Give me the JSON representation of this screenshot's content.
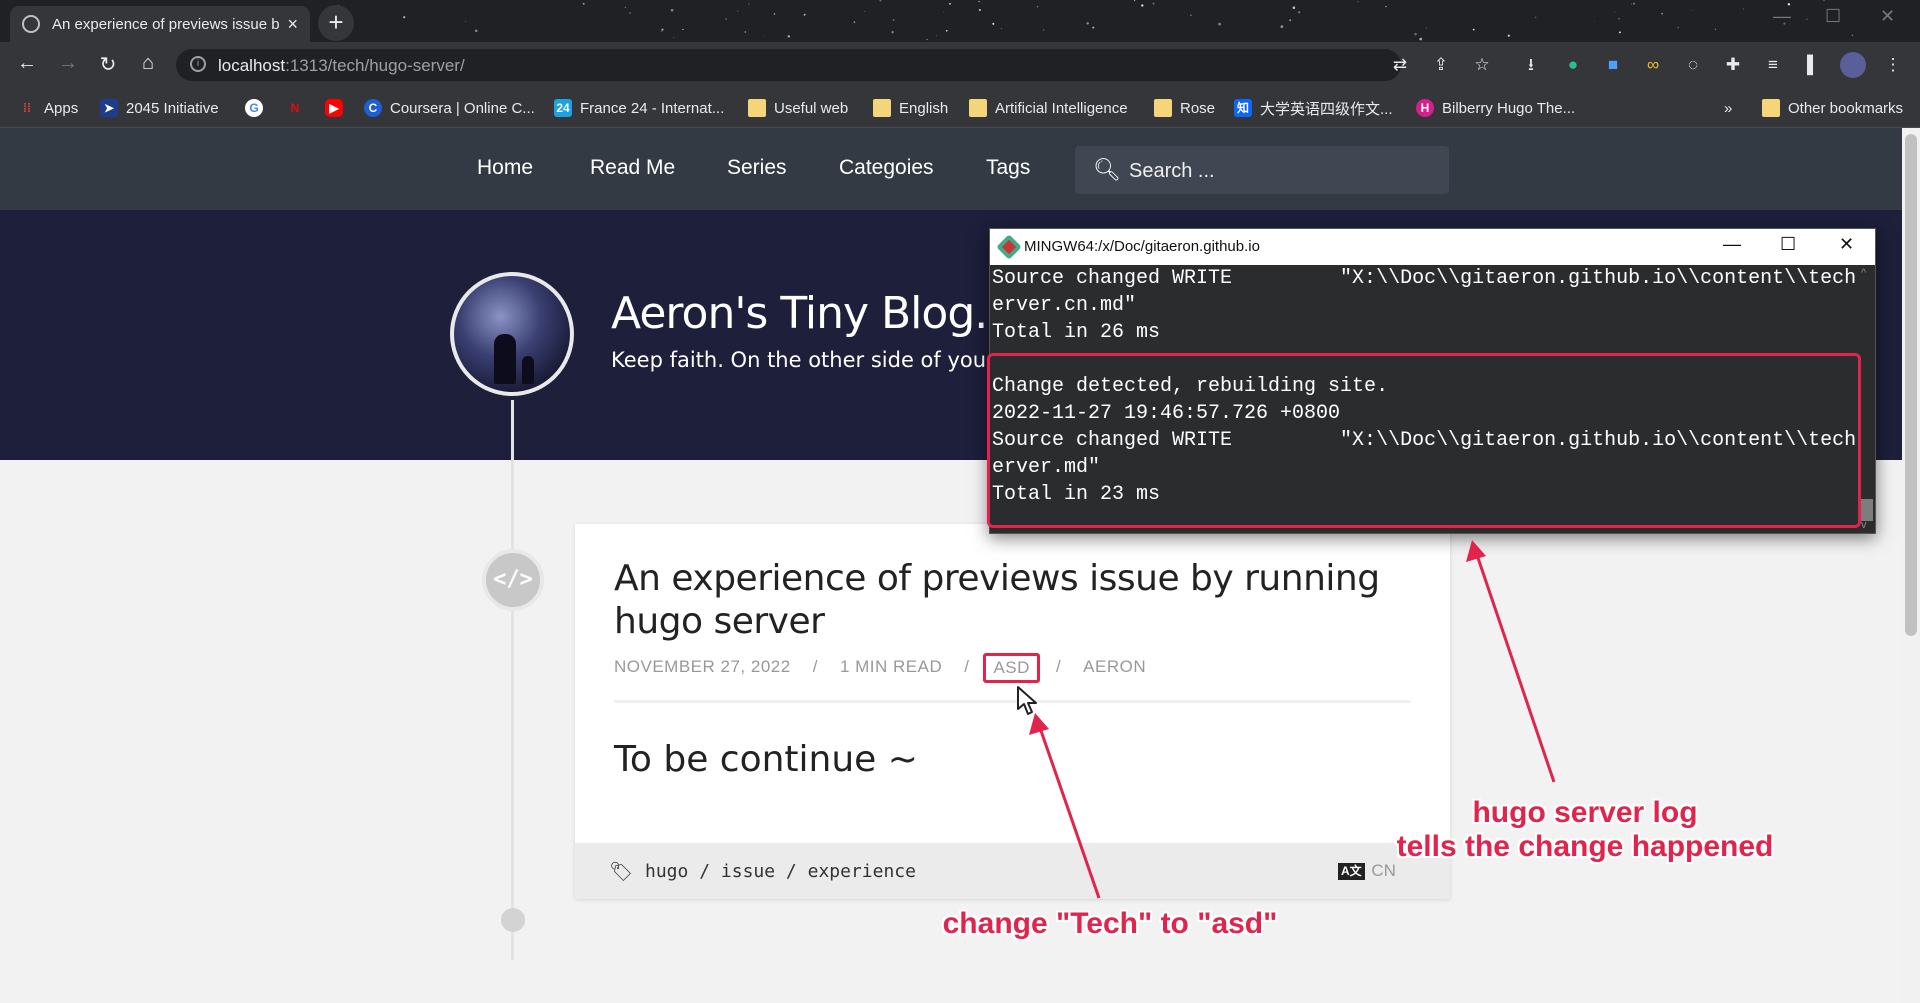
{
  "browser": {
    "tab_title": "An experience of previews issue by running hugo server",
    "tab_close": "×",
    "new_tab": "+",
    "url_host": "localhost",
    "url_path": ":1313/tech/hugo-server/",
    "bookmarks": [
      {
        "label": "Apps",
        "icon": "apps-grid-icon"
      },
      {
        "label": "2045 Initiative",
        "icon": "2045-initiative-icon"
      },
      {
        "label": "",
        "icon": "google-icon"
      },
      {
        "label": "",
        "icon": "netflix-icon"
      },
      {
        "label": "",
        "icon": "youtube-icon"
      },
      {
        "label": "Coursera | Online C...",
        "icon": "coursera-icon"
      },
      {
        "label": "France 24 - Internat...",
        "icon": "france24-icon"
      },
      {
        "label": "Useful web",
        "icon": "folder-icon"
      },
      {
        "label": "English",
        "icon": "folder-icon"
      },
      {
        "label": "Artificial Intelligence",
        "icon": "folder-icon"
      },
      {
        "label": "Rose",
        "icon": "folder-icon"
      },
      {
        "label": "大学英语四级作文...",
        "icon": "zhihu-icon"
      },
      {
        "label": "Bilberry Hugo The...",
        "icon": "bilberry-icon"
      }
    ],
    "more_bookmarks": "»",
    "other_bookmarks": "Other bookmarks"
  },
  "site": {
    "nav": [
      "Home",
      "Read Me",
      "Series",
      "Categoies",
      "Tags"
    ],
    "search_placeholder": "Search ...",
    "blog_title": "Aeron's Tiny Blog.",
    "blog_subtitle": "Keep faith. On the other side of your"
  },
  "post": {
    "title": "An experience of previews issue by running hugo server",
    "date": "NOVEMBER 27, 2022",
    "read_time": "1 MIN READ",
    "category": "ASD",
    "author": "AERON",
    "separator": "/",
    "body": "To be continue ~",
    "tags": [
      "hugo",
      "issue",
      "experience"
    ],
    "lang_icon": "A文",
    "lang": "CN"
  },
  "terminal": {
    "title": "MINGW64:/x/Doc/gitaeron.github.io",
    "lines": [
      "Source changed WRITE         \"X:\\\\Doc\\\\gitaeron.github.io\\\\content\\\\tech",
      "erver.cn.md\"",
      "Total in 26 ms",
      "",
      "Change detected, rebuilding site.",
      "2022-11-27 19:46:57.726 +0800",
      "Source changed WRITE         \"X:\\\\Doc\\\\gitaeron.github.io\\\\content\\\\tech",
      "erver.md\"",
      "Total in 23 ms"
    ]
  },
  "annotations": {
    "log_note_line1": "hugo server log",
    "log_note_line2": "tells the change happened",
    "category_note": "change \"Tech\" to \"asd\""
  },
  "colors": {
    "accent_red": "#e0244b",
    "nav_bg": "#343a43",
    "hero_bg": "#1d1f3b"
  }
}
